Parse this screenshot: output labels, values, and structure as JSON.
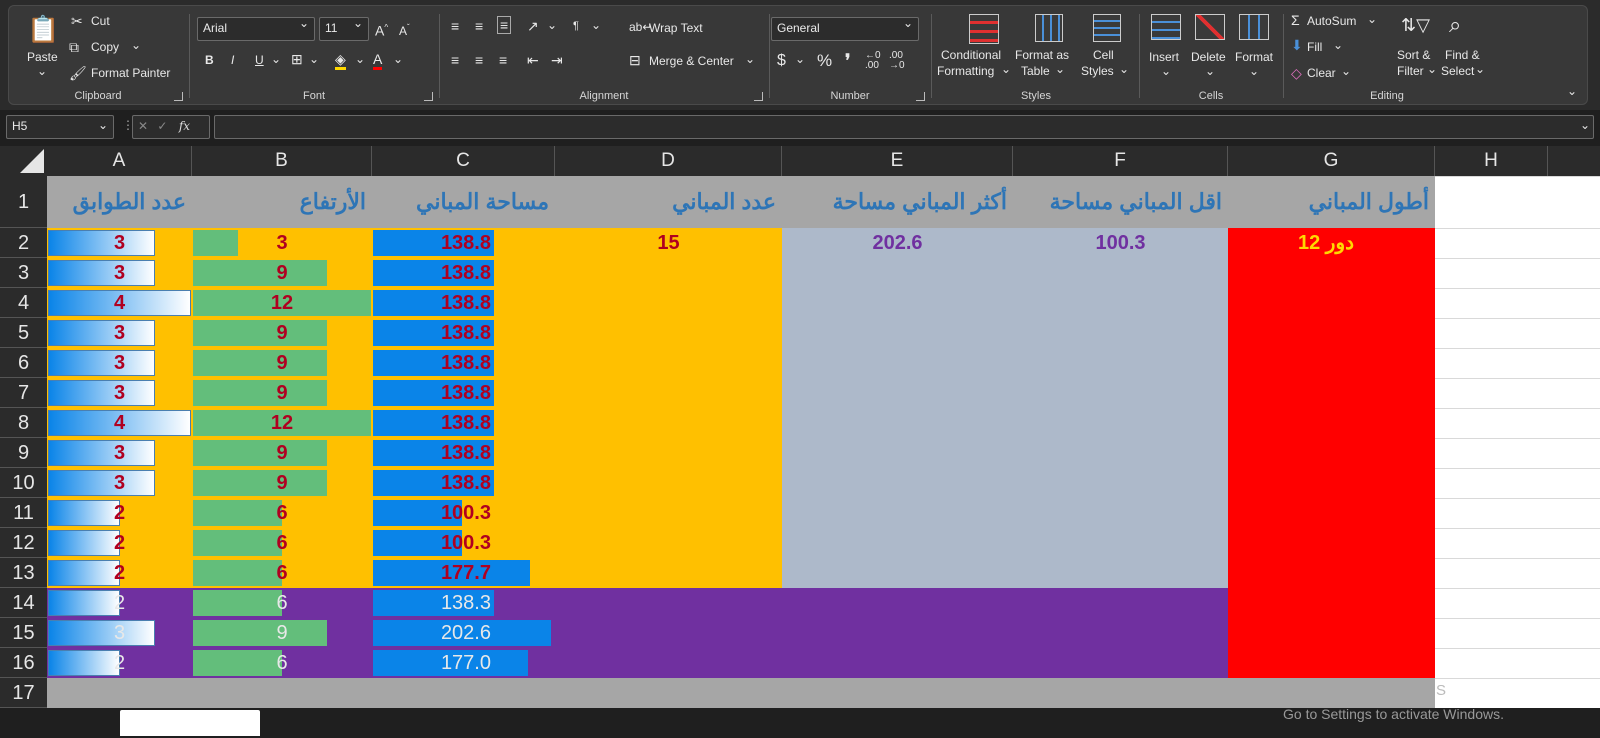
{
  "ribbon": {
    "clipboard": {
      "paste": "Paste",
      "cut": "Cut",
      "copy": "Copy",
      "format_painter": "Format Painter",
      "label": "Clipboard"
    },
    "font": {
      "name": "Arial",
      "size": "11",
      "bold": "B",
      "italic": "I",
      "underline": "U",
      "label": "Font"
    },
    "alignment": {
      "wrap_text": "Wrap Text",
      "merge_center": "Merge & Center",
      "label": "Alignment"
    },
    "number": {
      "format": "General",
      "currency": "$",
      "percent": "%",
      "comma": "❜",
      "label": "Number"
    },
    "styles": {
      "conditional": "Conditional",
      "conditional2": "Formatting",
      "format_as": "Format as",
      "format_as2": "Table",
      "cell": "Cell",
      "cell2": "Styles",
      "label": "Styles"
    },
    "cells": {
      "insert": "Insert",
      "delete": "Delete",
      "format": "Format",
      "label": "Cells"
    },
    "editing": {
      "autosum": "AutoSum",
      "fill": "Fill",
      "clear": "Clear",
      "sort": "Sort &",
      "sort2": "Filter",
      "find": "Find &",
      "find2": "Select",
      "label": "Editing"
    }
  },
  "formula_bar": {
    "name_box": "H5",
    "fx": "fx",
    "value": ""
  },
  "columns": [
    "A",
    "B",
    "C",
    "D",
    "E",
    "F",
    "G",
    "H"
  ],
  "rows": [
    "1",
    "2",
    "3",
    "4",
    "5",
    "6",
    "7",
    "8",
    "9",
    "10",
    "11",
    "12",
    "13",
    "14",
    "15",
    "16",
    "17"
  ],
  "headers": {
    "A": "عدد الطوابق",
    "B": "الأرتفاع",
    "C": "مساحة المباني",
    "D": "عدد المباني",
    "E": "أكثر المباني مساحة",
    "F": "اقل المباني مساحة",
    "G": "أطول المباني"
  },
  "table": {
    "floors": [
      "3",
      "3",
      "4",
      "3",
      "3",
      "3",
      "4",
      "3",
      "3",
      "2",
      "2",
      "2",
      "2",
      "3",
      "2"
    ],
    "height": [
      "3",
      "9",
      "12",
      "9",
      "9",
      "9",
      "12",
      "9",
      "9",
      "6",
      "6",
      "6",
      "6",
      "9",
      "6"
    ],
    "area": [
      "138.8",
      "138.8",
      "138.8",
      "138.8",
      "138.8",
      "138.8",
      "138.8",
      "138.8",
      "138.8",
      "100.3",
      "100.3",
      "177.7",
      "138.3",
      "202.6",
      "177.0"
    ],
    "floors_bar": [
      0.75,
      0.75,
      1,
      0.75,
      0.75,
      0.75,
      1,
      0.75,
      0.75,
      0.5,
      0.5,
      0.5,
      0.5,
      0.75,
      0.5
    ],
    "height_bar": [
      0.25,
      0.75,
      1,
      0.75,
      0.75,
      0.75,
      1,
      0.75,
      0.75,
      0.5,
      0.5,
      0.5,
      0.5,
      0.75,
      0.5
    ],
    "area_bar": [
      0.68,
      0.68,
      0.68,
      0.68,
      0.68,
      0.68,
      0.68,
      0.68,
      0.68,
      0.5,
      0.5,
      0.88,
      0.68,
      1,
      0.87
    ]
  },
  "summary": {
    "building_count": "15",
    "max_area": "202.6",
    "min_area": "100.3",
    "tallest": "دور 12"
  },
  "colors": {
    "orange": "#ffc000",
    "grey_blue": "#adb9ca",
    "red": "#ff0000",
    "purple": "#7030a0",
    "header_grey": "#a6a6a6",
    "header_text": "#2e75b6",
    "bar_blue": "#0a84e8",
    "bar_green": "#63be7b"
  },
  "watermark": {
    "s": "S",
    "activate": "Go to Settings to activate Windows."
  }
}
